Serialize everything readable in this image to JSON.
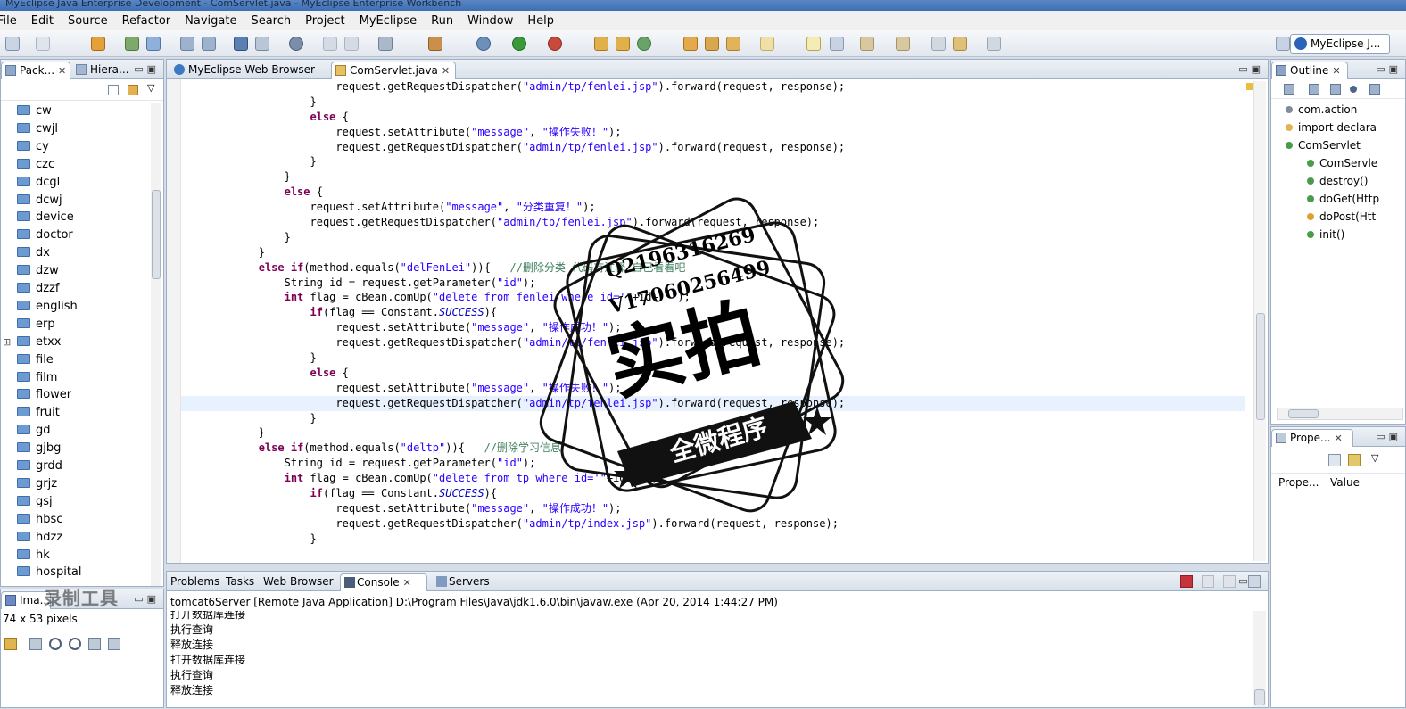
{
  "window": {
    "title": "MyEclipse Java Enterprise Development - ComServlet.java - MyEclipse Enterprise Workbench"
  },
  "menu": [
    "File",
    "Edit",
    "Source",
    "Refactor",
    "Navigate",
    "Search",
    "Project",
    "MyEclipse",
    "Run",
    "Window",
    "Help"
  ],
  "perspective": {
    "label": "MyEclipse J..."
  },
  "package_explorer": {
    "tabs": [
      "Pack...",
      "Hiera..."
    ],
    "items": [
      "cw",
      "cwjl",
      "cy",
      "czc",
      "dcgl",
      "dcwj",
      "device",
      "doctor",
      "dx",
      "dzw",
      "dzzf",
      "english",
      "erp",
      "etxx",
      "file",
      "film",
      "flower",
      "fruit",
      "gd",
      "gjbg",
      "grdd",
      "grjz",
      "gsj",
      "hbsc",
      "hdzz",
      "hk",
      "hospital"
    ]
  },
  "editor": {
    "tabs": [
      "MyEclipse Web Browser",
      "ComServlet.java"
    ],
    "lines": [
      "                        request.getRequestDispatcher(\"admin/tp/fenlei.jsp\").forward(request, response);",
      "                    }",
      "                    else {",
      "                        request.setAttribute(\"message\", \"操作失败！\");",
      "                        request.getRequestDispatcher(\"admin/tp/fenlei.jsp\").forward(request, response);",
      "                    }",
      "                }",
      "                else {",
      "                    request.setAttribute(\"message\", \"分类重复！\");",
      "                    request.getRequestDispatcher(\"admin/tp/fenlei.jsp\").forward(request, response);",
      "                }",
      "            }",
      "            else if(method.equals(\"delFenLei\")){   //删除分类 代码有注释 自己看看吧",
      "                String id = request.getParameter(\"id\");",
      "                int flag = cBean.comUp(\"delete from fenlei where id='\"+id+\"'\");",
      "                    if(flag == Constant.SUCCESS){",
      "                        request.setAttribute(\"message\", \"操作成功！\");",
      "                        request.getRequestDispatcher(\"admin/tp/fenlei.jsp\").forward(request, response);",
      "                    }",
      "                    else {",
      "                        request.setAttribute(\"message\", \"操作失败！\");",
      "                        request.getRequestDispatcher(\"admin/tp/fenlei.jsp\").forward(request, response);",
      "                    }",
      "            }",
      "            else if(method.equals(\"deltp\")){   //删除学习信息",
      "                String id = request.getParameter(\"id\");",
      "                int flag = cBean.comUp(\"delete from tp where id='\"+id+\"'\");",
      "                    if(flag == Constant.SUCCESS){",
      "                        request.setAttribute(\"message\", \"操作成功！\");",
      "                        request.getRequestDispatcher(\"admin/tp/index.jsp\").forward(request, response);",
      "                    }"
    ]
  },
  "outline": {
    "tab": "Outline",
    "items": [
      "com.action",
      "import declara",
      "ComServlet",
      "ComServle",
      "destroy()",
      "doGet(Http",
      "doPost(Htt",
      "init()"
    ]
  },
  "properties": {
    "tab": "Prope...",
    "columns": [
      "Prope...",
      "Value"
    ]
  },
  "bottom": {
    "tabs": [
      "Problems",
      "Tasks",
      "Web Browser",
      "Console",
      "Servers"
    ],
    "console_header": "tomcat6Server [Remote Java Application] D:\\Program Files\\Java\\jdk1.6.0\\bin\\javaw.exe (Apr 20, 2014 1:44:27 PM)",
    "console_lines": [
      "打开数据库连接",
      "执行查询",
      "释放连接",
      "打开数据库连接",
      "执行查询",
      "释放连接"
    ]
  },
  "image_panel": {
    "tab": "Ima...",
    "info": "74 x 53 pixels"
  },
  "watermark": {
    "line1": "Q2196316269",
    "line2": "V17060256499",
    "main": "实拍",
    "banner": "全微程序",
    "corner": "录制工具"
  }
}
